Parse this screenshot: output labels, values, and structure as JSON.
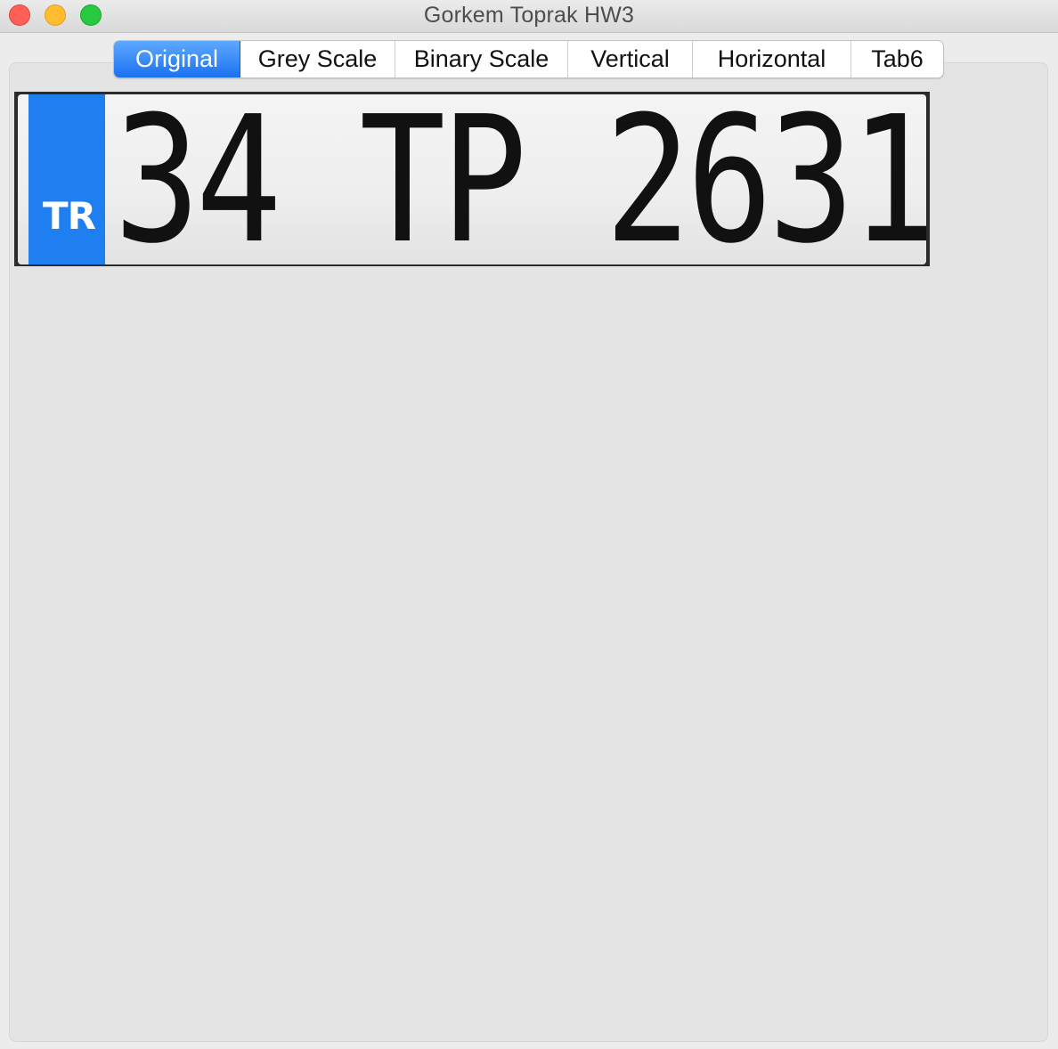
{
  "window": {
    "title": "Gorkem Toprak HW3"
  },
  "tabs": [
    {
      "label": "Original",
      "selected": true
    },
    {
      "label": "Grey Scale",
      "selected": false
    },
    {
      "label": "Binary Scale",
      "selected": false
    },
    {
      "label": "Vertical",
      "selected": false
    },
    {
      "label": "Horizontal",
      "selected": false
    },
    {
      "label": "Tab6",
      "selected": false
    }
  ],
  "image": {
    "country_code": "TR",
    "plate_text": "34 TP 2631",
    "band_color": "#1f7ef0"
  },
  "colors": {
    "tab_selected": "#1a72f0",
    "close": "#fe5f57",
    "minimize": "#febc2e",
    "maximize": "#28c840"
  }
}
